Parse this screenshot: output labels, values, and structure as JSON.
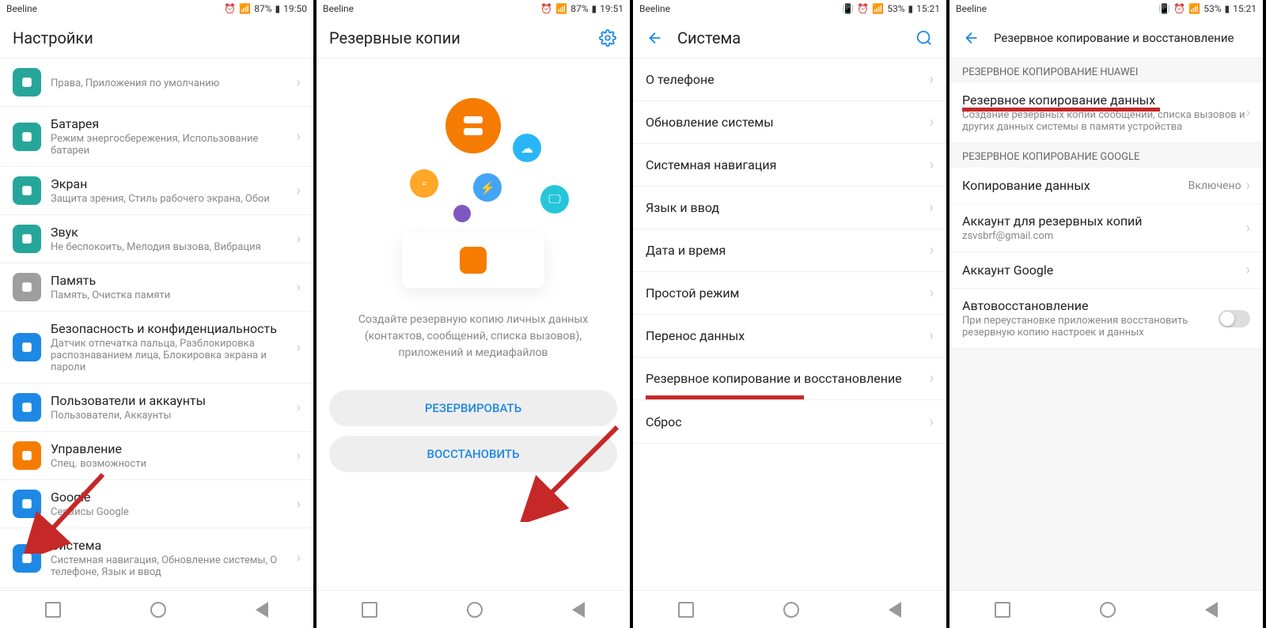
{
  "screens": [
    {
      "status": {
        "carrier": "Beeline",
        "battery": "87%",
        "time": "19:50"
      },
      "header": {
        "title": "Настройки"
      },
      "items": [
        {
          "title": "",
          "sub": "Права, Приложения по умолчанию",
          "color": "#26a69a"
        },
        {
          "title": "Батарея",
          "sub": "Режим энергосбережения, Использование батареи",
          "color": "#26a69a"
        },
        {
          "title": "Экран",
          "sub": "Защита зрения, Стиль рабочего экрана, Обои",
          "color": "#26a69a"
        },
        {
          "title": "Звук",
          "sub": "Не беспокоить, Мелодия вызова, Вибрация",
          "color": "#26a69a"
        },
        {
          "title": "Память",
          "sub": "Память, Очистка памяти",
          "color": "#9e9e9e"
        },
        {
          "title": "Безопасность и конфиденциальность",
          "sub": "Датчик отпечатка пальца, Разблокировка распознаванием лица, Блокировка экрана и пароли",
          "color": "#1e88e5"
        },
        {
          "title": "Пользователи и аккаунты",
          "sub": "Пользователи, Аккаунты",
          "color": "#1e88e5"
        },
        {
          "title": "Управление",
          "sub": "Спец. возможности",
          "color": "#f57c00"
        },
        {
          "title": "Google",
          "sub": "Сервисы Google",
          "color": "#1e88e5"
        },
        {
          "title": "Система",
          "sub": "Системная навигация, Обновление системы, О телефоне, Язык и ввод",
          "color": "#1e88e5"
        }
      ]
    },
    {
      "status": {
        "carrier": "Beeline",
        "battery": "87%",
        "time": "19:51"
      },
      "header": {
        "title": "Резервные копии"
      },
      "desc": "Создайте резервную копию личных данных (контактов, сообщений, списка вызовов), приложений и медиафайлов",
      "buttons": {
        "backup": "РЕЗЕРВИРОВАТЬ",
        "restore": "ВОССТАНОВИТЬ"
      }
    },
    {
      "status": {
        "carrier": "Beeline",
        "battery": "53%",
        "time": "15:21"
      },
      "header": {
        "title": "Система"
      },
      "items": [
        "О телефоне",
        "Обновление системы",
        "Системная навигация",
        "Язык и ввод",
        "Дата и время",
        "Простой режим",
        "Перенос данных",
        "Резервное копирование и восстановление",
        "Сброс"
      ]
    },
    {
      "status": {
        "carrier": "Beeline",
        "battery": "53%",
        "time": "15:21"
      },
      "header": {
        "title": "Резервное копирование и восстановление"
      },
      "section1": "РЕЗЕРВНОЕ КОПИРОВАНИЕ HUAWEI",
      "huawei": {
        "title": "Резервное копирование данных",
        "sub": "Создание резервных копий сообщений, списка вызовов и других данных системы в памяти устройства"
      },
      "section2": "РЕЗЕРВНОЕ КОПИРОВАНИЕ GOOGLE",
      "google": [
        {
          "title": "Копирование данных",
          "value": "Включено"
        },
        {
          "title": "Аккаунт для резервных копий",
          "sub": "zsvsbrf@gmail.com"
        },
        {
          "title": "Аккаунт Google"
        },
        {
          "title": "Автовосстановление",
          "sub": "При переустановке приложения восстановить резервную копию настроек и данных",
          "toggle": true
        }
      ]
    }
  ]
}
